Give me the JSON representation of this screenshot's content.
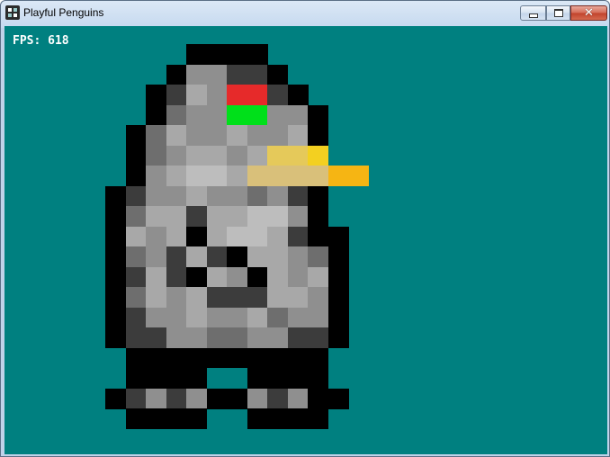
{
  "window": {
    "title": "Playful Penguins",
    "minimize_icon": "minimize-icon",
    "maximize_icon": "maximize-icon",
    "close_icon": "close-icon"
  },
  "hud": {
    "fps_text": "FPS: 618"
  },
  "colors": {
    "background": "#008080",
    "eye_red": "#e62a2a",
    "eye_green": "#00e01a",
    "beak": "#f5c218"
  }
}
